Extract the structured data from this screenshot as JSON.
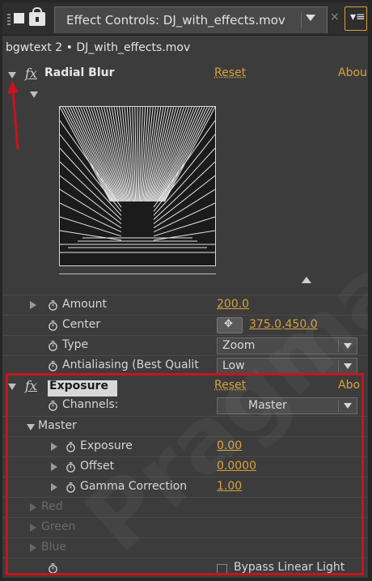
{
  "panel": {
    "title": "Effect Controls: DJ_with_effects.mov",
    "close_glyph": "×",
    "menu_glyph": "▾≡",
    "breadcrumb": "bgwtext 2 • DJ_with_effects.mov"
  },
  "radial_blur": {
    "fx_label": "fx",
    "name": "Radial Blur",
    "reset": "Reset",
    "about": "Abou",
    "properties": [
      {
        "label": "Amount",
        "value": "200.0"
      },
      {
        "label": "Center",
        "value": "375.0,450.0"
      },
      {
        "label": "Type",
        "value": "Zoom"
      },
      {
        "label": "Antialiasing (Best Qualit",
        "value": "Low"
      }
    ]
  },
  "exposure": {
    "fx_label": "fx",
    "name": "Exposure",
    "reset": "Reset",
    "about": "Abo",
    "channels_label": "Channels:",
    "channels_value": "Master",
    "master_label": "Master",
    "master_properties": [
      {
        "label": "Exposure",
        "value": "0.00"
      },
      {
        "label": "Offset",
        "value": "0.0000"
      },
      {
        "label": "Gamma Correction",
        "value": "1.00"
      }
    ],
    "disabled_groups": [
      "Red",
      "Green",
      "Blue"
    ],
    "bypass_label": "Bypass Linear Light"
  },
  "icons": {
    "center_target": "✥",
    "stopwatch": "stopwatch-icon"
  },
  "colors": {
    "accent": "#d9a13d",
    "annotation_red": "#c8141d",
    "panel_bg": "#3c3c3c"
  },
  "watermark": "Pragmatic"
}
